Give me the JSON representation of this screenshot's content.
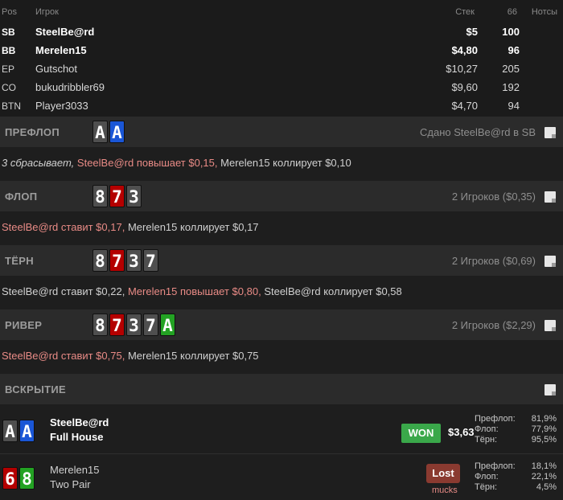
{
  "header": {
    "pos": "Pos",
    "player": "Игрок",
    "stack": "Стек",
    "stat": "66",
    "notes": "Нотсы"
  },
  "players": [
    {
      "pos": "SB",
      "name": "SteelBe@rd",
      "stack": "$5",
      "stat": "100"
    },
    {
      "pos": "BB",
      "name": "Merelen15",
      "stack": "$4,80",
      "stat": "96"
    },
    {
      "pos": "EP",
      "name": "Gutschot",
      "stack": "$10,27",
      "stat": "205"
    },
    {
      "pos": "CO",
      "name": "bukudribbler69",
      "stack": "$9,60",
      "stat": "192"
    },
    {
      "pos": "BTN",
      "name": "Player3033",
      "stack": "$4,70",
      "stat": "94"
    }
  ],
  "streets": {
    "preflop": {
      "title": "ПРЕФЛОП",
      "info": "Сдано SteelBe@rd в SB",
      "cards": [
        {
          "rank": "A",
          "suit": "spades",
          "color": "#4f4f4f"
        },
        {
          "rank": "A",
          "suit": "diamonds",
          "color": "#1a56d6"
        }
      ]
    },
    "flop": {
      "title": "ФЛОП",
      "info": "2 Игроков ($0,35)",
      "cards": [
        {
          "rank": "8",
          "suit": "spades",
          "color": "#4f4f4f"
        },
        {
          "rank": "7",
          "suit": "hearts",
          "color": "#b40000"
        },
        {
          "rank": "3",
          "suit": "spades",
          "color": "#4f4f4f"
        }
      ]
    },
    "turn": {
      "title": "ТЁРН",
      "info": "2 Игроков ($0,69)",
      "cards": [
        {
          "rank": "8",
          "suit": "spades",
          "color": "#4f4f4f"
        },
        {
          "rank": "7",
          "suit": "hearts",
          "color": "#b40000"
        },
        {
          "rank": "3",
          "suit": "spades",
          "color": "#4f4f4f"
        },
        {
          "rank": "7",
          "suit": "spades",
          "color": "#4f4f4f"
        }
      ]
    },
    "river": {
      "title": "РИВЕР",
      "info": "2 Игроков ($2,29)",
      "cards": [
        {
          "rank": "8",
          "suit": "spades",
          "color": "#4f4f4f"
        },
        {
          "rank": "7",
          "suit": "hearts",
          "color": "#b40000"
        },
        {
          "rank": "3",
          "suit": "spades",
          "color": "#4f4f4f"
        },
        {
          "rank": "7",
          "suit": "spades",
          "color": "#4f4f4f"
        },
        {
          "rank": "A",
          "suit": "clubs",
          "color": "#23a223"
        }
      ]
    },
    "showdown": {
      "title": "ВСКРЫТИЕ"
    }
  },
  "actions": {
    "preflop": {
      "a1": "3 сбрасывает,",
      "a2": "SteelBe@rd повышает $0,15,",
      "a3": "Merelen15 коллирует $0,10"
    },
    "flop": {
      "a1": "SteelBe@rd ставит $0,17,",
      "a2": "Merelen15 коллирует $0,17"
    },
    "turn": {
      "a1": "SteelBe@rd ставит $0,22,",
      "a2": "Merelen15 повышает $0,80,",
      "a3": "SteelBe@rd коллирует $0,58"
    },
    "river": {
      "a1": "SteelBe@rd ставит $0,75,",
      "a2": "Merelen15 коллирует $0,75"
    }
  },
  "showdown": {
    "winner": {
      "name": "SteelBe@rd",
      "hand": "Full House",
      "badge": "WON",
      "amount": "$3,63",
      "cards": [
        {
          "rank": "A",
          "suit": "spades"
        },
        {
          "rank": "A",
          "suit": "diamonds"
        }
      ],
      "equity": [
        {
          "label": "Префлоп:",
          "value": "81,9%"
        },
        {
          "label": "Флоп:",
          "value": "77,9%"
        },
        {
          "label": "Тёрн:",
          "value": "95,5%"
        }
      ]
    },
    "loser": {
      "name": "Merelen15",
      "hand": "Two Pair",
      "badge": "Lost",
      "status": "mucks",
      "cards": [
        {
          "rank": "6",
          "suit": "hearts"
        },
        {
          "rank": "8",
          "suit": "clubs"
        }
      ],
      "equity": [
        {
          "label": "Префлоп:",
          "value": "18,1%"
        },
        {
          "label": "Флоп:",
          "value": "22,1%"
        },
        {
          "label": "Тёрн:",
          "value": "4,5%"
        }
      ]
    }
  },
  "colors": {
    "accent_red": "#e98b86",
    "won": "#3aa84a",
    "lost": "#8a3a30",
    "hearts": "#b40000",
    "diamonds": "#1a56d6",
    "clubs": "#23a223",
    "spades": "#4f4f4f"
  }
}
